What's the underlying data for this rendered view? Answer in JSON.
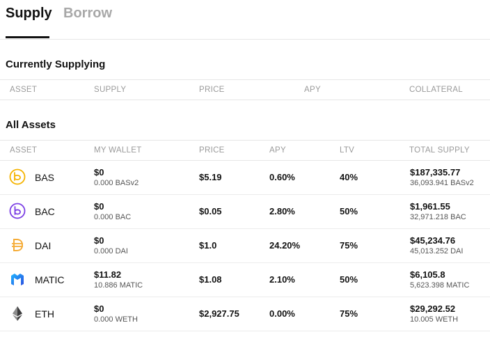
{
  "tabs": {
    "supply": "Supply",
    "borrow": "Borrow"
  },
  "currently_supplying": {
    "title": "Currently Supplying",
    "columns": [
      "ASSET",
      "SUPPLY",
      "PRICE",
      "APY",
      "COLLATERAL"
    ]
  },
  "all_assets": {
    "title": "All Assets",
    "columns": [
      "ASSET",
      "MY WALLET",
      "PRICE",
      "APY",
      "LTV",
      "TOTAL SUPPLY"
    ],
    "rows": [
      {
        "icon": "bas-token-icon",
        "symbol": "BAS",
        "wallet_usd": "$0",
        "wallet_amount": "0.000 BASv2",
        "price": "$5.19",
        "apy": "0.60%",
        "ltv": "40%",
        "total_usd": "$187,335.77",
        "total_amount": "36,093.941 BASv2"
      },
      {
        "icon": "bac-token-icon",
        "symbol": "BAC",
        "wallet_usd": "$0",
        "wallet_amount": "0.000 BAC",
        "price": "$0.05",
        "apy": "2.80%",
        "ltv": "50%",
        "total_usd": "$1,961.55",
        "total_amount": "32,971.218 BAC"
      },
      {
        "icon": "dai-token-icon",
        "symbol": "DAI",
        "wallet_usd": "$0",
        "wallet_amount": "0.000 DAI",
        "price": "$1.0",
        "apy": "24.20%",
        "ltv": "75%",
        "total_usd": "$45,234.76",
        "total_amount": "45,013.252 DAI"
      },
      {
        "icon": "matic-token-icon",
        "symbol": "MATIC",
        "wallet_usd": "$11.82",
        "wallet_amount": "10.886 MATIC",
        "price": "$1.08",
        "apy": "2.10%",
        "ltv": "50%",
        "total_usd": "$6,105.8",
        "total_amount": "5,623.398 MATIC"
      },
      {
        "icon": "eth-token-icon",
        "symbol": "ETH",
        "wallet_usd": "$0",
        "wallet_amount": "0.000 WETH",
        "price": "$2,927.75",
        "apy": "0.00%",
        "ltv": "75%",
        "total_usd": "$29,292.52",
        "total_amount": "10.005 WETH"
      }
    ]
  },
  "colors": {
    "bas": "#f5b300",
    "bac": "#7b3fe4",
    "dai": "#f5ac37",
    "matic": "#2b6def",
    "eth": "#3c3c3d"
  }
}
